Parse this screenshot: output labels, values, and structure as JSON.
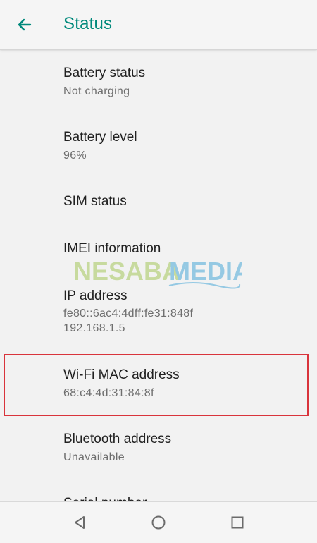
{
  "appbar": {
    "title": "Status",
    "back_icon": "arrow-left-icon",
    "accent_color": "#00897b"
  },
  "items": [
    {
      "title": "Battery status",
      "subtitle": "Not charging"
    },
    {
      "title": "Battery level",
      "subtitle": "96%"
    },
    {
      "title": "SIM status"
    },
    {
      "title": "IMEI information"
    },
    {
      "title": "IP address",
      "subtitle": "fe80::6ac4:4dff:fe31:848f",
      "subtitle2": "192.168.1.5"
    },
    {
      "title": "Wi-Fi MAC address",
      "subtitle": "68:c4:4d:31:84:8f"
    },
    {
      "title": "Bluetooth address",
      "subtitle": "Unavailable"
    },
    {
      "title": "Serial number"
    }
  ],
  "highlight": {
    "target": "Wi-Fi MAC address",
    "color": "#d9343c"
  },
  "watermark": {
    "text_left": "NESABA",
    "text_right": "MEDIA"
  },
  "navbar": {
    "back_icon": "triangle-back-icon",
    "home_icon": "circle-home-icon",
    "recents_icon": "square-recents-icon"
  }
}
